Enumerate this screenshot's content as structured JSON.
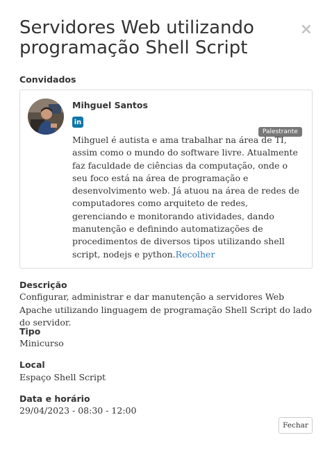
{
  "modal": {
    "title": "Servidores Web utilizando programação Shell Script",
    "close_glyph": "×"
  },
  "guests": {
    "heading": "Convidados",
    "speaker": {
      "name": "Mihguel Santos",
      "social_icon": "linkedin-icon",
      "social_glyph": "in",
      "role_badge": "Palestrante",
      "bio": "Mihguel é autista e ama trabalhar na área de TI, assim como o mundo do software livre. Atualmente faz faculdade de ciências da computação, onde o seu foco está na área de programação e desenvolvimento web. Já atuou na área de redes de computadores como arquiteto de redes, gerenciando e monitorando atividades, dando manutenção e definindo automatizações de procedimentos de diversos tipos utilizando shell script, nodejs e python.",
      "collapse_link": "Recolher"
    }
  },
  "details": {
    "description_label": "Descrição",
    "description_value": "Configurar, administrar e dar manutenção a servidores Web Apache utilizando linguagem de programação Shell Script do lado do servidor.",
    "type_label": "Tipo",
    "type_value": "Minicurso",
    "location_label": "Local",
    "location_value": "Espaço Shell Script",
    "datetime_label": "Data e horário",
    "datetime_value": "29/04/2023 - 08:30 - 12:00"
  },
  "footer": {
    "close_button": "Fechar"
  },
  "colors": {
    "link": "#337ab7",
    "linkedin": "#0e76a8",
    "badge": "#777777",
    "border": "#dddddd"
  }
}
